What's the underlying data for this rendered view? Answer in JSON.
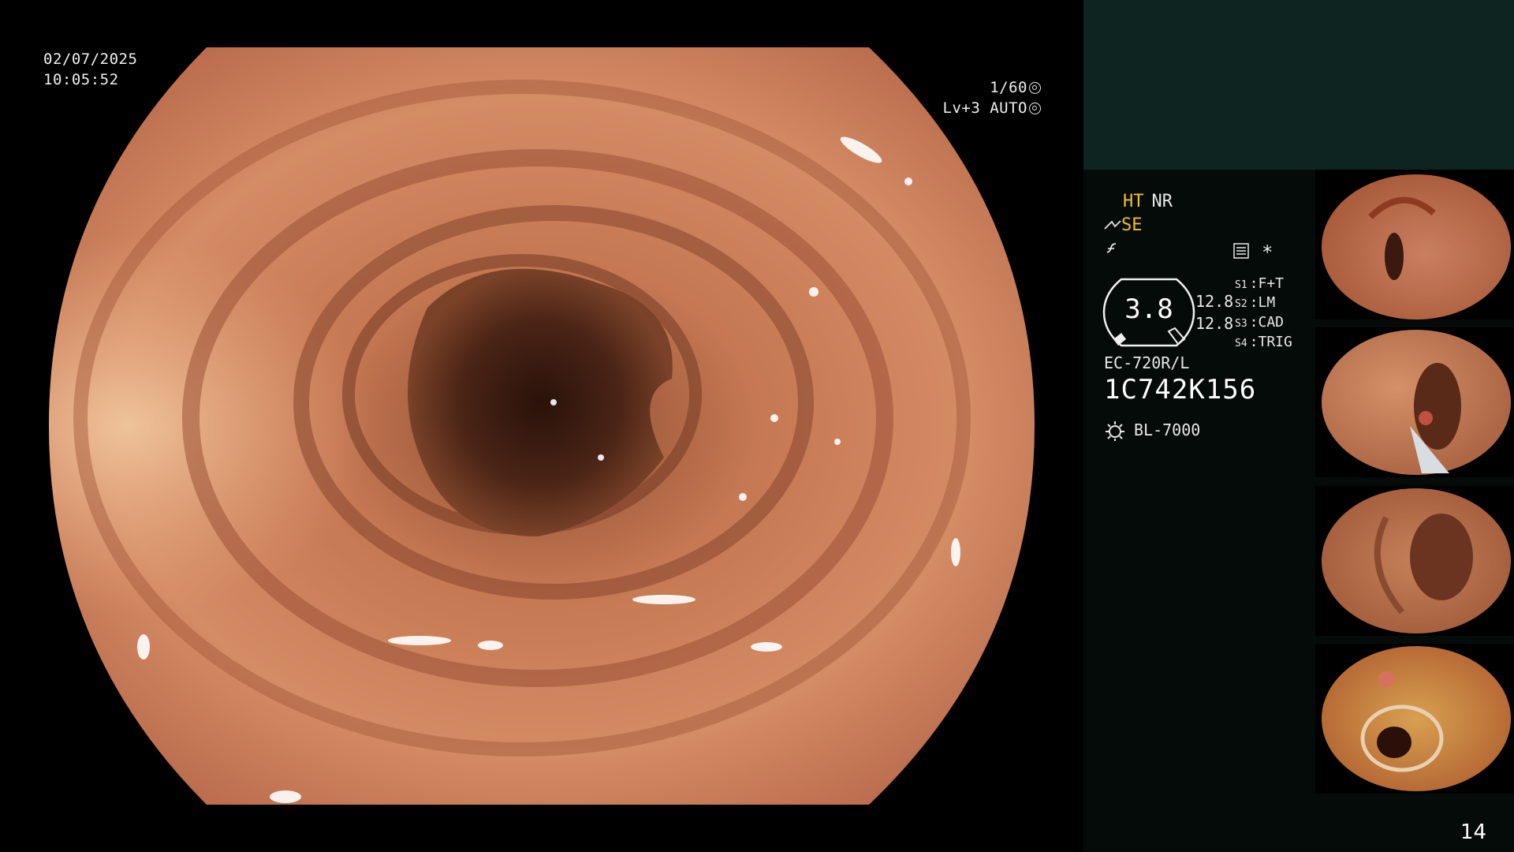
{
  "overlay": {
    "date": "02/07/2025",
    "time": "10:05:52",
    "shutter": "1/60",
    "level": "Lv+3",
    "iris": "AUTO"
  },
  "panel": {
    "mode_ht": "HT",
    "mode_nr": "NR",
    "mode_se": "SE",
    "asterisk": "*",
    "gauge_value": "3.8",
    "gauge_line1": "12.8",
    "gauge_line2": "12.8",
    "switches": [
      {
        "key": "S1",
        "value": "F+T"
      },
      {
        "key": "S2",
        "value": "LM"
      },
      {
        "key": "S3",
        "value": "CAD"
      },
      {
        "key": "S4",
        "value": "TRIG"
      }
    ],
    "scope_model": "EC-720R/L",
    "scope_serial": "1C742K156",
    "light_source": "BL-7000",
    "page_number": "14"
  },
  "icons": [
    "shutter-dial-icon",
    "iris-dial-icon",
    "scope-tip-icon",
    "function-icon",
    "list-icon",
    "light-source-icon"
  ],
  "colors": {
    "amber": "#f0c020",
    "panel_bg": "#050b09",
    "panel_header": "#0e2420",
    "mucosa": "#c97a55"
  }
}
